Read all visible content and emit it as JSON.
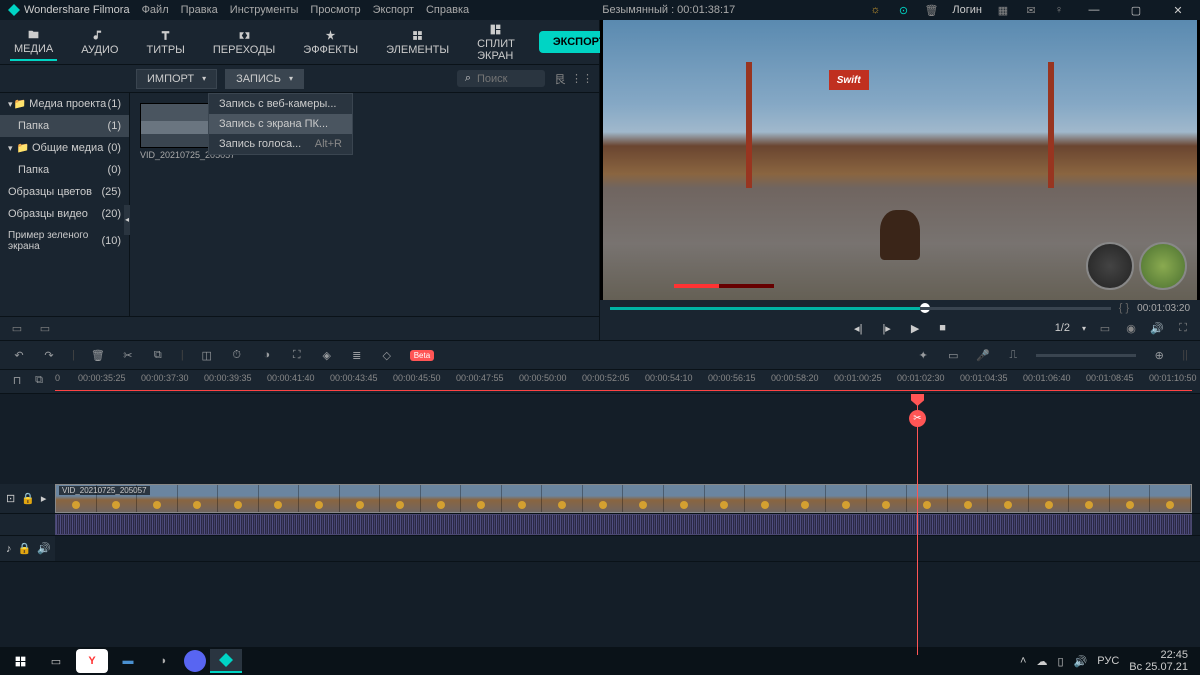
{
  "app": {
    "name": "Wondershare Filmora",
    "project_status": "Безымянный : 00:01:38:17",
    "login": "Логин"
  },
  "menu": [
    "Файл",
    "Правка",
    "Инструменты",
    "Просмотр",
    "Экспорт",
    "Справка"
  ],
  "tabs": [
    {
      "label": "МЕДИА"
    },
    {
      "label": "АУДИО"
    },
    {
      "label": "ТИТРЫ"
    },
    {
      "label": "ПЕРЕХОДЫ"
    },
    {
      "label": "ЭФФЕКТЫ"
    },
    {
      "label": "ЭЛЕМЕНТЫ"
    },
    {
      "label": "СПЛИТ ЭКРАН"
    }
  ],
  "export_btn": "ЭКСПОРТ",
  "import_btn": "ИМПОРТ",
  "record_btn": "ЗАПИСЬ",
  "record_menu": [
    {
      "label": "Запись с веб-камеры...",
      "shortcut": ""
    },
    {
      "label": "Запись с экрана ПК...",
      "shortcut": ""
    },
    {
      "label": "Запись голоса...",
      "shortcut": "Alt+R"
    }
  ],
  "search": {
    "placeholder": "Поиск"
  },
  "sidebar": [
    {
      "label": "Медиа проекта",
      "count": "(1)",
      "expand": true,
      "folder": true
    },
    {
      "label": "Папка",
      "count": "(1)",
      "selected": true
    },
    {
      "label": "Общие медиа",
      "count": "(0)",
      "expand": true,
      "folder": true
    },
    {
      "label": "Папка",
      "count": "(0)"
    },
    {
      "label": "Образцы цветов",
      "count": "(25)"
    },
    {
      "label": "Образцы видео",
      "count": "(20)"
    },
    {
      "label": "Пример зеленого экрана",
      "count": "(10)"
    }
  ],
  "clip": {
    "name": "VID_20210725_205057"
  },
  "preview": {
    "sign": "Swift",
    "duration": "00:01:03:20",
    "braces": "{      }",
    "ratio": "1/2"
  },
  "ruler": [
    "0",
    "00:00:35:25",
    "00:00:37:30",
    "00:00:39:35",
    "00:00:41:40",
    "00:00:43:45",
    "00:00:45:50",
    "00:00:47:55",
    "00:00:50:00",
    "00:00:52:05",
    "00:00:54:10",
    "00:00:56:15",
    "00:00:58:20",
    "00:01:00:25",
    "00:01:02:30",
    "00:01:04:35",
    "00:01:06:40",
    "00:01:08:45",
    "00:01:10:50"
  ],
  "timeline": {
    "clip_label": "VID_20210725_205057"
  },
  "taskbar": {
    "lang": "РУС",
    "time": "22:45",
    "date": "Вс 25.07.21"
  }
}
